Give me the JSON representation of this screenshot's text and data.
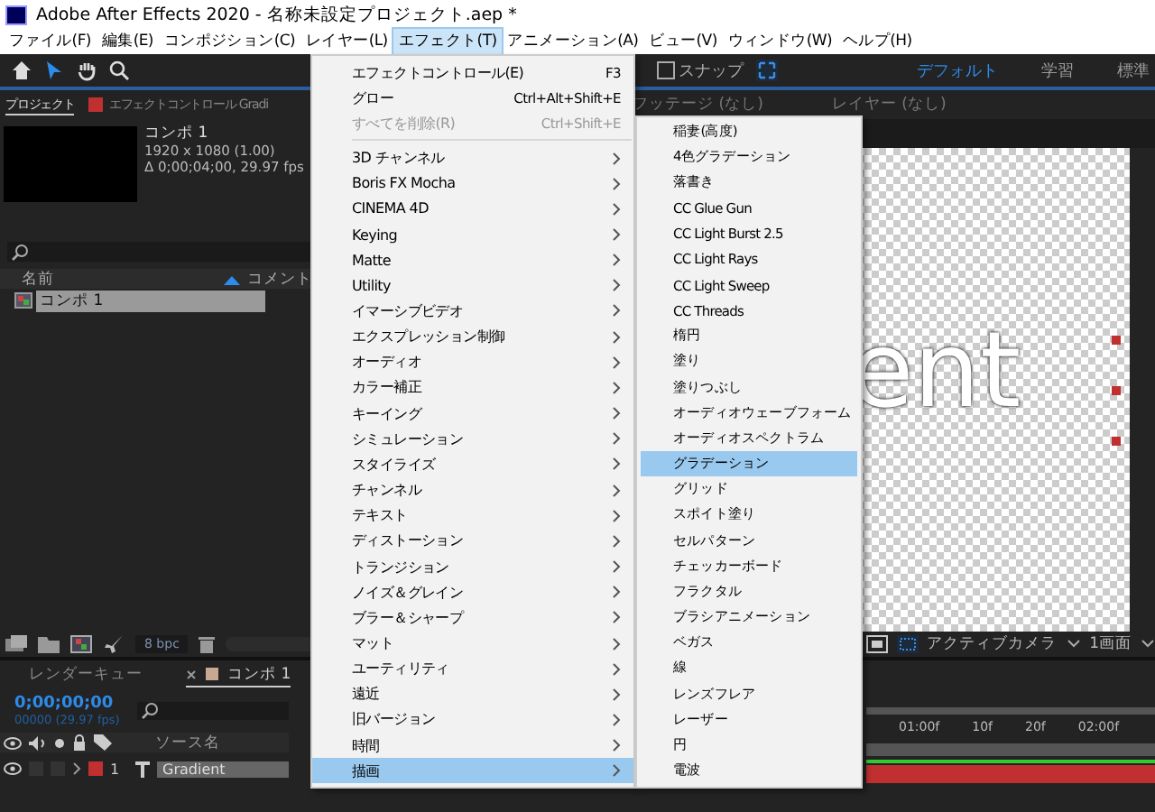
{
  "window": {
    "title": "Adobe After Effects 2020 - 名称未設定プロジェクト.aep *"
  },
  "menu_bar": [
    {
      "label": "ファイル(F)",
      "selected": false
    },
    {
      "label": "編集(E)",
      "selected": false
    },
    {
      "label": "コンポジション(C)",
      "selected": false
    },
    {
      "label": "レイヤー(L)",
      "selected": false
    },
    {
      "label": "エフェクト(T)",
      "selected": true
    },
    {
      "label": "アニメーション(A)",
      "selected": false
    },
    {
      "label": "ビュー(V)",
      "selected": false
    },
    {
      "label": "ウィンドウ(W)",
      "selected": false
    },
    {
      "label": "ヘルプ(H)",
      "selected": false
    }
  ],
  "toolbar": {
    "snap": {
      "label": "スナップ",
      "checked": false
    },
    "workspaces": [
      {
        "label": "デフォルト",
        "selected": true
      },
      {
        "label": "学習",
        "selected": false
      },
      {
        "label": "標準",
        "selected": false
      }
    ]
  },
  "project_panel": {
    "tabs": [
      {
        "label": "プロジェクト",
        "selected": true,
        "kind": "plain"
      },
      {
        "label": "エフェクトコントロール Gradi",
        "selected": false,
        "kind": "swatch",
        "color": "#c03030"
      }
    ],
    "comp": {
      "name": "コンポ 1",
      "size": "1920 x 1080 (1.00)",
      "duration": "Δ 0;00;04;00, 29.97 fps"
    },
    "columns": [
      "名前",
      "コメント"
    ],
    "items": [
      {
        "name": "コンポ 1",
        "selected": true
      }
    ],
    "bit_depth": "8 bpc"
  },
  "viewer": {
    "tabs": [
      "フッテージ (なし)",
      "レイヤー (なし)"
    ],
    "text": "ent",
    "camera": "アクティブカメラ",
    "views": "1画面"
  },
  "effect_menu": [
    {
      "label": "エフェクトコントロール(E)",
      "kind": "command",
      "shortcut": "F3",
      "disabled": false,
      "selected": false
    },
    {
      "label": "グロー",
      "kind": "command",
      "shortcut": "Ctrl+Alt+Shift+E",
      "disabled": false,
      "selected": false
    },
    {
      "label": "すべてを削除(R)",
      "kind": "command",
      "shortcut": "Ctrl+Shift+E",
      "disabled": true,
      "selected": false
    },
    {
      "label": "3D チャンネル",
      "kind": "submenu",
      "disabled": false,
      "selected": false
    },
    {
      "label": "Boris FX Mocha",
      "kind": "submenu",
      "disabled": false,
      "selected": false
    },
    {
      "label": "CINEMA 4D",
      "kind": "submenu",
      "disabled": false,
      "selected": false
    },
    {
      "label": "Keying",
      "kind": "submenu",
      "disabled": false,
      "selected": false
    },
    {
      "label": "Matte",
      "kind": "submenu",
      "disabled": false,
      "selected": false
    },
    {
      "label": "Utility",
      "kind": "submenu",
      "disabled": false,
      "selected": false
    },
    {
      "label": "イマーシブビデオ",
      "kind": "submenu",
      "disabled": false,
      "selected": false
    },
    {
      "label": "エクスプレッション制御",
      "kind": "submenu",
      "disabled": false,
      "selected": false
    },
    {
      "label": "オーディオ",
      "kind": "submenu",
      "disabled": false,
      "selected": false
    },
    {
      "label": "カラー補正",
      "kind": "submenu",
      "disabled": false,
      "selected": false
    },
    {
      "label": "キーイング",
      "kind": "submenu",
      "disabled": false,
      "selected": false
    },
    {
      "label": "シミュレーション",
      "kind": "submenu",
      "disabled": false,
      "selected": false
    },
    {
      "label": "スタイライズ",
      "kind": "submenu",
      "disabled": false,
      "selected": false
    },
    {
      "label": "チャンネル",
      "kind": "submenu",
      "disabled": false,
      "selected": false
    },
    {
      "label": "テキスト",
      "kind": "submenu",
      "disabled": false,
      "selected": false
    },
    {
      "label": "ディストーション",
      "kind": "submenu",
      "disabled": false,
      "selected": false
    },
    {
      "label": "トランジション",
      "kind": "submenu",
      "disabled": false,
      "selected": false
    },
    {
      "label": "ノイズ＆グレイン",
      "kind": "submenu",
      "disabled": false,
      "selected": false
    },
    {
      "label": "ブラー＆シャープ",
      "kind": "submenu",
      "disabled": false,
      "selected": false
    },
    {
      "label": "マット",
      "kind": "submenu",
      "disabled": false,
      "selected": false
    },
    {
      "label": "ユーティリティ",
      "kind": "submenu",
      "disabled": false,
      "selected": false
    },
    {
      "label": "遠近",
      "kind": "submenu",
      "disabled": false,
      "selected": false
    },
    {
      "label": "旧バージョン",
      "kind": "submenu",
      "disabled": false,
      "selected": false
    },
    {
      "label": "時間",
      "kind": "submenu",
      "disabled": false,
      "selected": false
    },
    {
      "label": "描画",
      "kind": "submenu",
      "disabled": false,
      "selected": true
    }
  ],
  "submenu": [
    {
      "label": "稲妻(高度)",
      "selected": false
    },
    {
      "label": "4色グラデーション",
      "selected": false
    },
    {
      "label": "落書き",
      "selected": false
    },
    {
      "label": "CC Glue Gun",
      "selected": false
    },
    {
      "label": "CC Light Burst 2.5",
      "selected": false
    },
    {
      "label": "CC Light Rays",
      "selected": false
    },
    {
      "label": "CC Light Sweep",
      "selected": false
    },
    {
      "label": "CC Threads",
      "selected": false
    },
    {
      "label": "楕円",
      "selected": false
    },
    {
      "label": "塗り",
      "selected": false
    },
    {
      "label": "塗りつぶし",
      "selected": false
    },
    {
      "label": "オーディオウェーブフォーム",
      "selected": false
    },
    {
      "label": "オーディオスペクトラム",
      "selected": false
    },
    {
      "label": "グラデーション",
      "selected": true
    },
    {
      "label": "グリッド",
      "selected": false
    },
    {
      "label": "スポイト塗り",
      "selected": false
    },
    {
      "label": "セルパターン",
      "selected": false
    },
    {
      "label": "チェッカーボード",
      "selected": false
    },
    {
      "label": "フラクタル",
      "selected": false
    },
    {
      "label": "ブラシアニメーション",
      "selected": false
    },
    {
      "label": "ベガス",
      "selected": false
    },
    {
      "label": "線",
      "selected": false
    },
    {
      "label": "レンズフレア",
      "selected": false
    },
    {
      "label": "レーザー",
      "selected": false
    },
    {
      "label": "円",
      "selected": false
    },
    {
      "label": "電波",
      "selected": false
    }
  ],
  "timeline": {
    "tabs": [
      {
        "label": "レンダーキュー",
        "selected": false
      },
      {
        "label": "コンポ 1",
        "selected": true
      }
    ],
    "timecode": "0;00;00;00",
    "frames": "00000 (29.97 fps)",
    "column": "ソース名",
    "layers": [
      {
        "number": "1",
        "name": "Gradient",
        "color": "#c03030"
      }
    ],
    "ruler": [
      "01:00f",
      "10f",
      "20f",
      "02:00f"
    ]
  }
}
